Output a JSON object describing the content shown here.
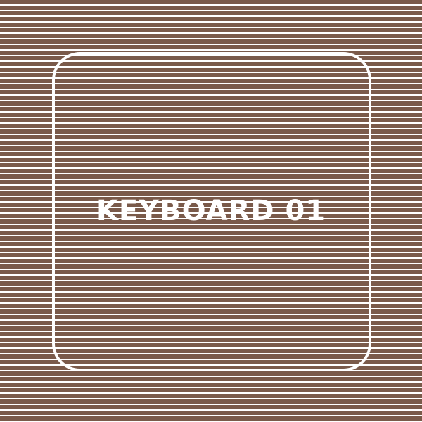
{
  "key": {
    "label": "KEYBOARD 01"
  },
  "colors": {
    "background": "#7a5a4a",
    "stripes": "#ffffff",
    "frame": "#ffffff",
    "text": "#ffffff"
  }
}
